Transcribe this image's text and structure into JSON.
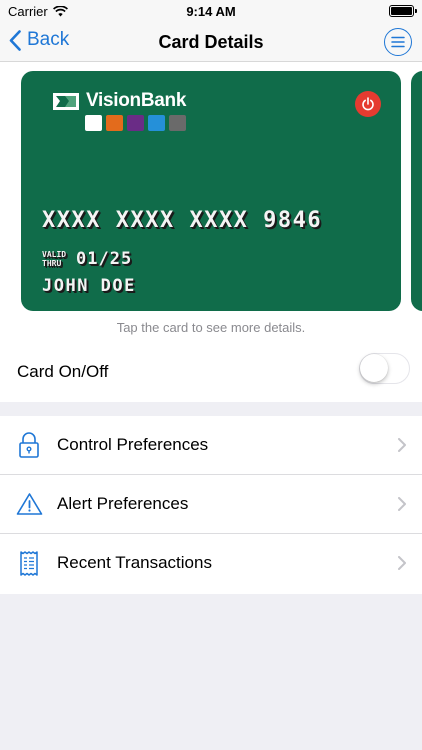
{
  "status_bar": {
    "carrier": "Carrier",
    "time": "9:14 AM"
  },
  "nav": {
    "back_label": "Back",
    "title": "Card Details"
  },
  "card": {
    "bank_name": "VisionBank",
    "swatch_colors": [
      "#ffffff",
      "#e36b1c",
      "#6a2c86",
      "#2590d9",
      "#6a6a6a"
    ],
    "number": "XXXX XXXX XXXX 9846",
    "valid_label_line1": "VALID",
    "valid_label_line2": "THRU",
    "expiry": "01/25",
    "holder": "JOHN DOE",
    "background_color": "#106c4a",
    "power_color": "#e53b30"
  },
  "card_hint": "Tap the card to see more details.",
  "card_toggle": {
    "label": "Card On/Off",
    "on": false
  },
  "menu": [
    {
      "label": "Control Preferences",
      "icon": "lock-icon"
    },
    {
      "label": "Alert Preferences",
      "icon": "warning-icon"
    },
    {
      "label": "Recent Transactions",
      "icon": "receipt-icon"
    }
  ],
  "accent_color": "#1f77d6"
}
